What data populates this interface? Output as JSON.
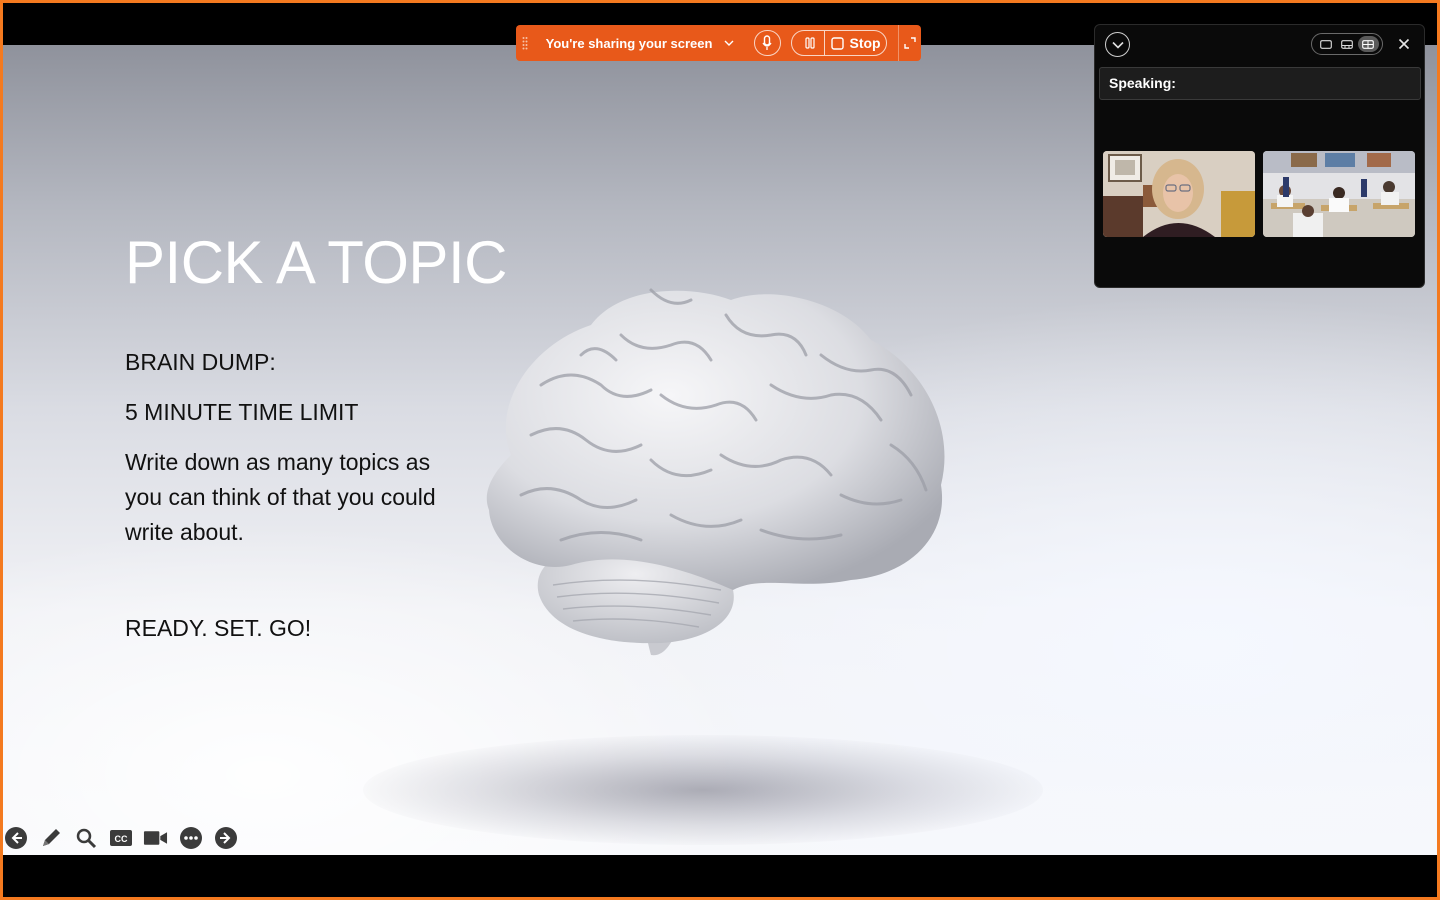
{
  "share_bar": {
    "label": "You're sharing your screen",
    "stop_label": "Stop",
    "icons": [
      "grip-icon",
      "chevron-down-icon",
      "microphone-icon",
      "pause-icon",
      "stop-icon",
      "expand-icon"
    ],
    "color": "#e8591a"
  },
  "video_panel": {
    "speaking_label": "Speaking:",
    "icons": [
      "chevron-down-icon",
      "single-view-icon",
      "speaker-view-icon",
      "gallery-view-icon",
      "close-icon"
    ],
    "active_view": "gallery"
  },
  "slide": {
    "title": "PICK A TOPIC",
    "line1": "BRAIN DUMP:",
    "line2": "5 MINUTE TIME LIMIT",
    "line3": "Write down as many topics as you can think of that you could write about.",
    "line4": "READY. SET. GO!"
  },
  "slide_toolbar": {
    "icons": [
      "arrow-left-icon",
      "pen-icon",
      "magnifier-icon",
      "closed-captions-icon",
      "video-camera-icon",
      "more-icon",
      "arrow-right-icon"
    ]
  },
  "colors": {
    "frame": "#f47a1f",
    "panel_bg": "#0a0a0a"
  }
}
